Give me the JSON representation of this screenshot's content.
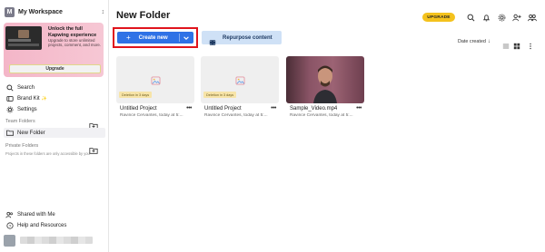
{
  "workspace": {
    "avatar_letter": "M",
    "name": "My Workspace"
  },
  "promo": {
    "title": "Unlock the full Kapwing experience",
    "description": "Upgrade to store unlimited projects, comment, and more.",
    "button_label": "Upgrade"
  },
  "nav": {
    "search": "Search",
    "brand_kit": "Brand Kit",
    "settings": "Settings",
    "team_folders": "Team Folders",
    "new_folder": "New Folder",
    "private_folders": "Private Folders",
    "private_note": "Projects in these folders are only accessible by you",
    "shared_with_me": "Shared with Me",
    "help": "Help and Resources"
  },
  "page": {
    "title": "New Folder",
    "upgrade_label": "UPGRADE",
    "create_new_label": "Create new",
    "repurpose_label": "Repurpose content",
    "sort_label": "Date created"
  },
  "cards": [
    {
      "name": "Untitled Project",
      "meta": "Ravince Cervantes, today at 5:...",
      "badge": "Deletion in 3 days"
    },
    {
      "name": "Untitled Project",
      "meta": "Ravince Cervantes, today at 5:...",
      "badge": "Deletion in 3 days"
    },
    {
      "name": "Sample_Video.mp4",
      "meta": "Ravince Cervantes, today at 5:..."
    }
  ],
  "colors": {
    "primary_blue": "#2f72e6",
    "highlight_red": "#e0141c",
    "upgrade_yellow": "#f4c21d",
    "repurpose_bg": "#cfe1f6",
    "promo_pink": "#f4b6c8"
  }
}
